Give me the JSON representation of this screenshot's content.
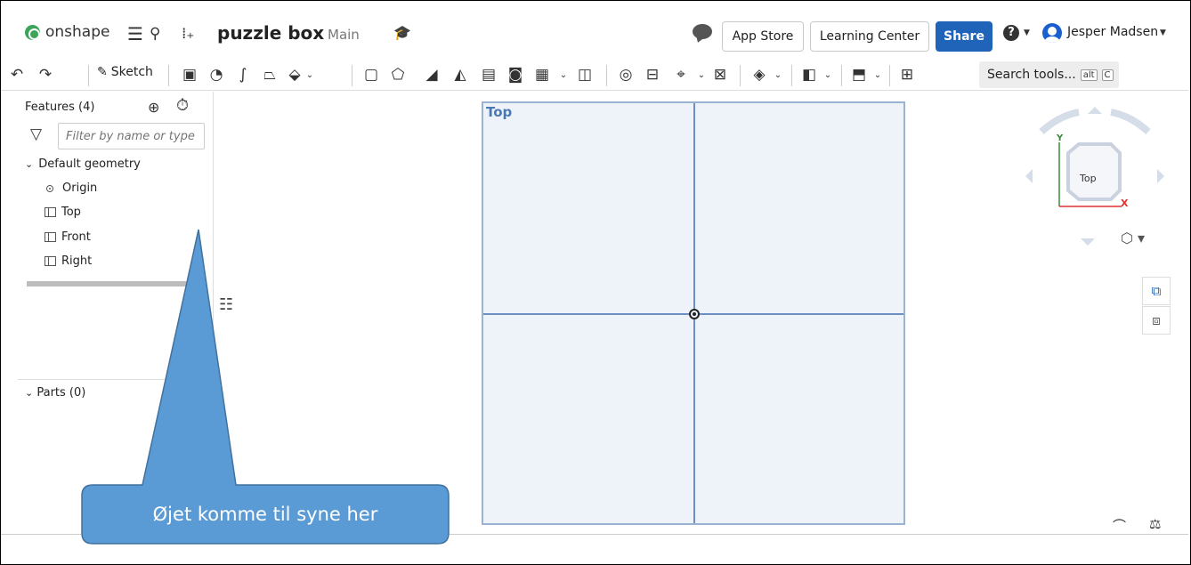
{
  "app": {
    "logo_text": "onshape",
    "document_title": "puzzle box",
    "branch": "Main"
  },
  "header": {
    "app_store": "App Store",
    "learning_center": "Learning Center",
    "share": "Share",
    "help": "?",
    "user_name": "Jesper Madsen"
  },
  "toolbar": {
    "sketch_label": "Sketch",
    "search_label": "Search tools...",
    "shortcut_alt": "alt",
    "shortcut_key": "C"
  },
  "feature_panel": {
    "title": "Features (4)",
    "filter_placeholder": "Filter by name or type",
    "default_geometry": "Default geometry",
    "items": [
      {
        "label": "Origin",
        "icon": "origin-icon"
      },
      {
        "label": "Top",
        "icon": "plane-icon"
      },
      {
        "label": "Front",
        "icon": "plane-icon"
      },
      {
        "label": "Right",
        "icon": "plane-icon"
      }
    ],
    "parts_title": "Parts (0)"
  },
  "canvas": {
    "plane_label": "Top"
  },
  "view_cube": {
    "face_label": "Top",
    "y_label": "Y",
    "x_label": "X"
  },
  "callout": {
    "text": "Øjet komme til syne her",
    "fill_color": "#5b9bd5",
    "stroke_color": "#41719c"
  }
}
